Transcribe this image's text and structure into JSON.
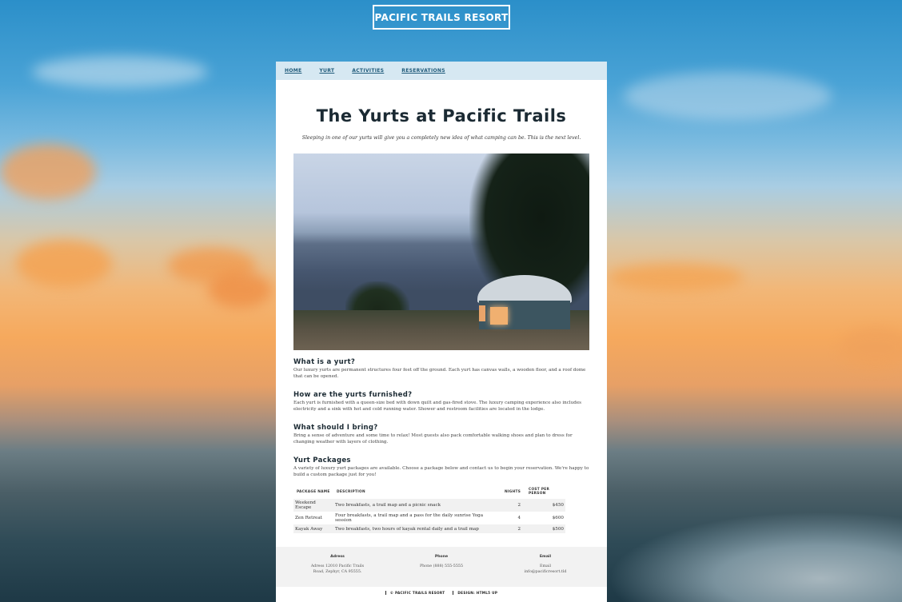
{
  "brand": "PACIFIC TRAILS RESORT",
  "nav": {
    "home": "HOME",
    "yurt": "YURT",
    "activities": "ACTIVITIES",
    "reservations": "RESERVATIONS"
  },
  "page": {
    "title": "The Yurts at Pacific Trails",
    "lead": "Sleeping in one of our yurts will give you a completely new idea of what camping can be. This is the next level."
  },
  "sections": [
    {
      "heading": "What is a yurt?",
      "text": "Our luxury yurts are permanent structures four feet off the ground. Each yurt has canvas walls, a wooden floor, and a roof dome that can be opened."
    },
    {
      "heading": "How are the yurts furnished?",
      "text": "Each yurt is furnished with a queen-size bed with down quilt and gas-fired stove. The luxury camping experience also includes electricity and a sink with hot and cold running water. Shower and restroom facilities are located in the lodge."
    },
    {
      "heading": "What should I bring?",
      "text": "Bring a sense of adventure and some time to relax! Most guests also pack comfortable walking shoes and plan to dress for changing weather with layers of clothing."
    },
    {
      "heading": "Yurt Packages",
      "text": "A variety of luxury yurt packages are available. Choose a package below and contact us to begin your reservation. We're happy to build a custom package just for you!"
    }
  ],
  "table": {
    "headers": [
      "PACKAGE NAME",
      "DESCRIPTION",
      "NIGHTS",
      "COST PER PERSON"
    ],
    "rows": [
      [
        "Weekend Escape",
        "Two breakfasts, a trail map and a picnic snack",
        "2",
        "$450"
      ],
      [
        "Zen Retreat",
        "Four breakfasts, a trail map and a pass for the daily sunrise Yoga session",
        "4",
        "$600"
      ],
      [
        "Kayak Away",
        "Two breakfasts, two hours of kayak rental daily and a trail map",
        "2",
        "$500"
      ]
    ]
  },
  "footer": {
    "address_heading": "Adress",
    "address_line1": "Adress 12010 Pacific Trails",
    "address_line2": "Road, Zephyr, CA 95555.",
    "phone_heading": "Phone",
    "phone_text": "Phone (888) 555-5555",
    "email_heading": "Email",
    "email_line1": "Email",
    "email_line2": "info@pacificresort.tld"
  },
  "bottom": {
    "copyright": "© PACIFIC TRAILS RESORT",
    "design": "DESIGN: HTML5 UP"
  }
}
